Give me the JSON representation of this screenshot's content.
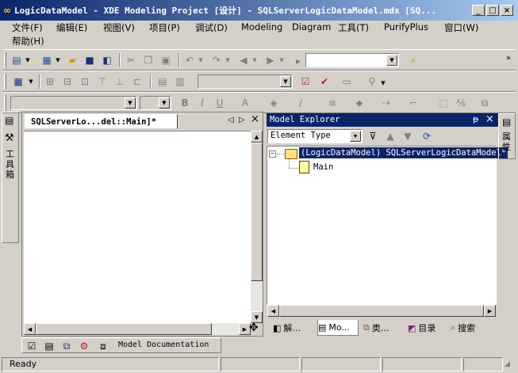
{
  "window": {
    "title": "LogicDataModel - XDE Modeling Project [设计] - SQLServerLogicDataModel.mdx [SQ...",
    "controls": [
      "_",
      "□",
      "×"
    ]
  },
  "menu": [
    "文件(F)",
    "编辑(E)",
    "视图(V)",
    "项目(P)",
    "调试(D)",
    "Modeling",
    "Diagram",
    "工具(T)",
    "PurifyPlus",
    "窗口(W)",
    "帮助(H)"
  ],
  "toolbox_tab": "工具箱",
  "document": {
    "tab_title": "SQLServerLo...del::Main]*",
    "nav_left": "◁",
    "nav_right": "▷",
    "close": "×"
  },
  "bottom_doc_tab": "Model Documentation",
  "explorer": {
    "title": "Model Explorer",
    "pin": "ᵽ",
    "close": "×",
    "filter_value": "Element Type",
    "root_label": "(LogicDataModel) SQLServerLogicDataModel*",
    "child_label": "Main",
    "expander": "−"
  },
  "explorer_tabs": [
    "解...",
    "Mo...",
    "类...",
    "目录",
    "搜索"
  ],
  "properties_tab": "属性",
  "status": {
    "text": "Ready"
  },
  "colors": {
    "titlebar": "#0a246a",
    "face": "#d4d0c8",
    "selection": "#0a246a"
  }
}
